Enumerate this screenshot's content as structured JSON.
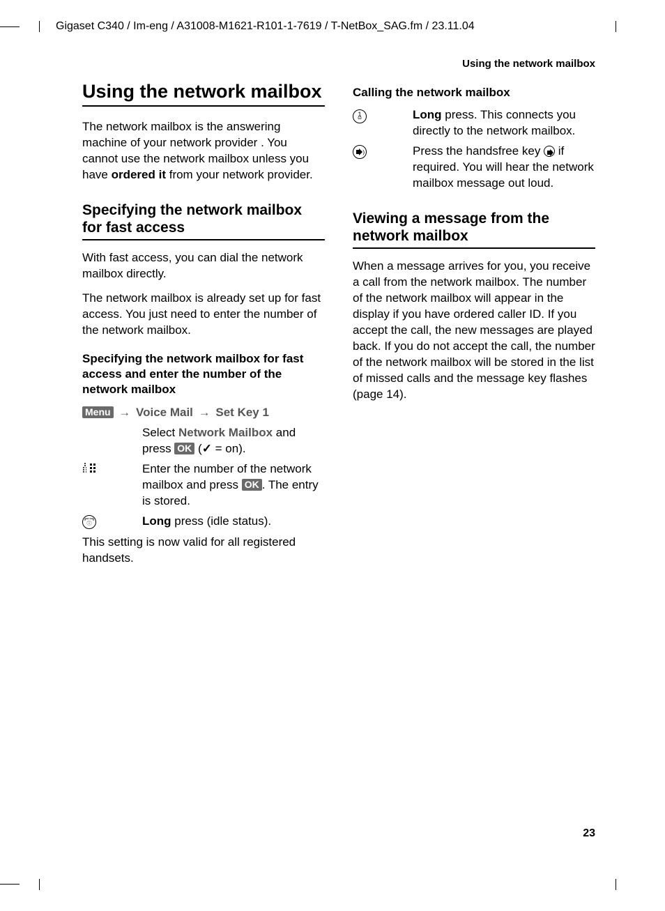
{
  "header_path": "Gigaset C340 / Im-eng / A31008-M1621-R101-1-7619 / T-NetBox_SAG.fm / 23.11.04",
  "running_head": "Using the network mailbox",
  "page_number": "23",
  "col1": {
    "title": "Using the network mailbox",
    "intro_a": "The network mailbox is the answering machine of your network provider . You cannot use the network mailbox unless you have ",
    "intro_bold": "ordered it",
    "intro_b": " from your network provider.",
    "sec1_title": "Specifying the network mailbox for fast access",
    "sec1_p1": "With fast access, you can dial the network mailbox directly.",
    "sec1_p2": "The network mailbox is already set up for fast access. You just need to enter the number of the network mailbox.",
    "sub1_title": "Specifying the network mailbox for fast access and enter the number of the network mailbox",
    "menu_label": "Menu",
    "voice_mail": "Voice Mail",
    "set_key1": "Set Key 1",
    "step1_a": "Select ",
    "step1_grey": "Network Mailbox",
    "step1_b": " and press ",
    "ok_label": "OK",
    "step1_c": " (",
    "step1_check": "✓",
    "step1_d": " = on).",
    "step2_a": "Enter the number of the net­work mailbox and press ",
    "step2_b": ". The entry is stored.",
    "step3_bold": "Long",
    "step3_rest": " press (idle status).",
    "closing": "This setting is now valid for all registered handsets."
  },
  "col2": {
    "sub2_title": "Calling the network mailbox",
    "call1_bold": "Long",
    "call1_rest": " press. This connects you directly to the network mail­box.",
    "call2_a": "Press the handsfree key ",
    "call2_b": " if required. You will hear the net­work mailbox message out loud.",
    "sec2_title": "Viewing a message from the network mailbox",
    "sec2_p": "When a message arrives for you, you receive a call from the network mailbox. The number of the network mailbox will appear in the display if you have ordered caller ID. If you accept the call, the new messages are played back. If you do not accept the call, the number of the network mailbox will be stored in the list of missed calls and the message key flashes (page 14)."
  }
}
